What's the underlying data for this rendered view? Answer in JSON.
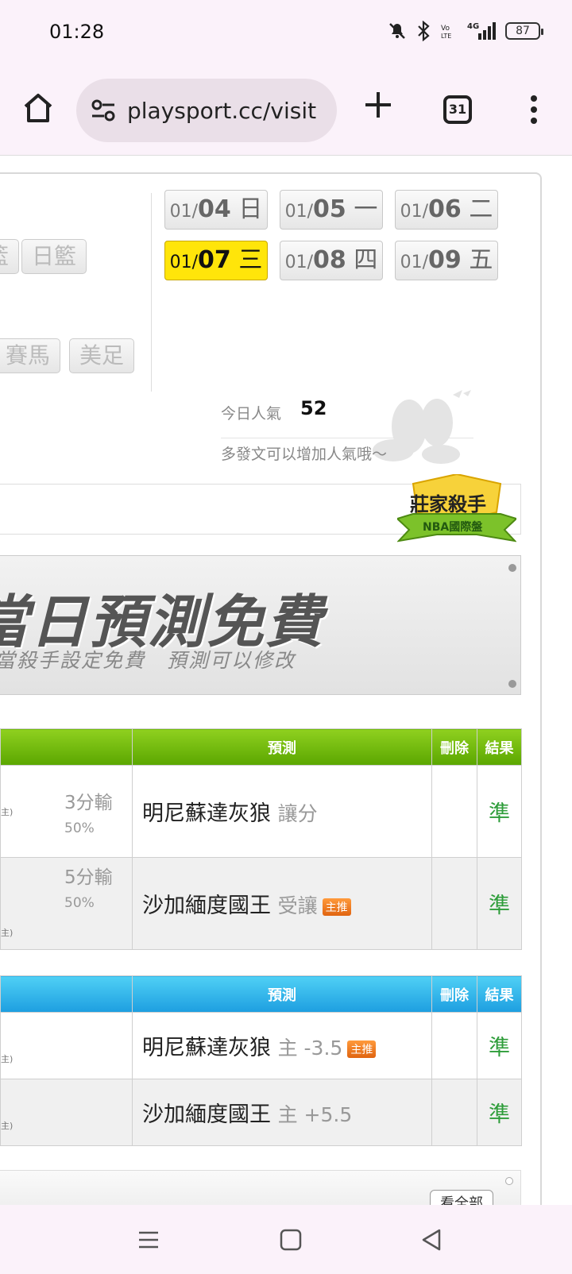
{
  "status_bar": {
    "time": "01:28",
    "battery": "87",
    "icons": [
      "mute-icon",
      "bluetooth-icon",
      "volte-icon",
      "signal-4g-icon",
      "battery-icon"
    ]
  },
  "browser": {
    "url": "playsport.cc/visit",
    "tab_count": "31"
  },
  "sport_buttons": {
    "row1_cut": "籃",
    "row1": "日籃",
    "row2": "賽馬",
    "row3": "美足"
  },
  "dates": [
    {
      "month": "01/",
      "day": "04",
      "weekday": " 日"
    },
    {
      "month": "01/",
      "day": "05",
      "weekday": " 一"
    },
    {
      "month": "01/",
      "day": "06",
      "weekday": " 二"
    },
    {
      "month": "01/",
      "day": "07",
      "weekday": " 三"
    },
    {
      "month": "01/",
      "day": "08",
      "weekday": " 四"
    },
    {
      "month": "01/",
      "day": "09",
      "weekday": " 五"
    }
  ],
  "popularity": {
    "label": "今日人氣",
    "count": "52",
    "hint": "多發文可以增加人氣哦～"
  },
  "badge": {
    "title": "莊家殺手",
    "subtitle": "NBA國際盤"
  },
  "banner": {
    "headline": "當日預測免費",
    "subline": "當殺手設定免費　預測可以修改"
  },
  "table1": {
    "headers": {
      "prediction": "預測",
      "delete": "刪除",
      "result": "結果"
    },
    "rows": [
      {
        "loss": "3分輸",
        "pct": "50%",
        "team": "明尼蘇達灰狼",
        "pick": "讓分",
        "tag": "",
        "result": "準",
        "tiny": "主)"
      },
      {
        "loss": "5分輸",
        "pct": "50%",
        "team": "沙加緬度國王",
        "pick": "受讓",
        "tag": "主推",
        "result": "準",
        "tiny": "主)"
      }
    ]
  },
  "table2": {
    "headers": {
      "prediction": "預測",
      "delete": "刪除",
      "result": "結果"
    },
    "rows": [
      {
        "team": "明尼蘇達灰狼",
        "pick": "主 -3.5",
        "tag": "主推",
        "result": "準",
        "tiny": "主)"
      },
      {
        "team": "沙加緬度國王",
        "pick": "主 +5.5",
        "tag": "",
        "result": "準",
        "tiny": "主)"
      }
    ]
  },
  "see_all": "看全部",
  "colors": {
    "active_date": "#ffe50a",
    "table1_header": "#6ab80a",
    "table2_header": "#2aaee8",
    "result_green": "#2e9d3a",
    "tag_orange": "#f07a1e"
  }
}
